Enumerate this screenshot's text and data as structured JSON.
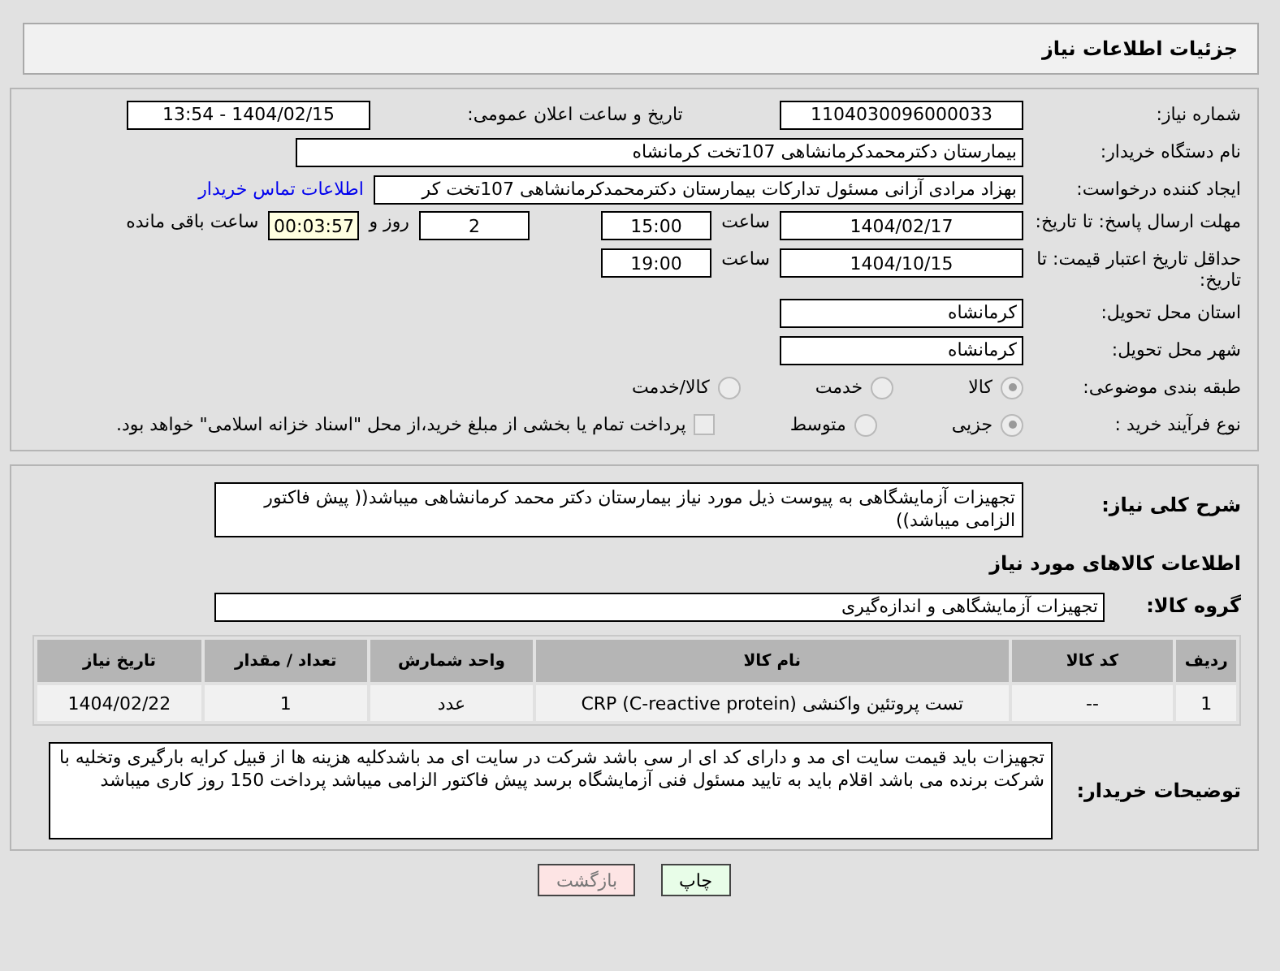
{
  "header": {
    "title": "جزئیات اطلاعات نیاز"
  },
  "fields": {
    "need_number": {
      "label": "شماره نیاز:",
      "value": "1104030096000033"
    },
    "announce": {
      "label": "تاریخ و ساعت اعلان عمومی:",
      "value": "1404/02/15 - 13:54"
    },
    "buyer_org": {
      "label": "نام دستگاه خریدار:",
      "value": "بیمارستان دکترمحمدکرمانشاهی 107تخت کرمانشاه"
    },
    "requester": {
      "label": "ایجاد کننده درخواست:",
      "value": "بهزاد مرادی آزانی مسئول تدارکات بیمارستان دکترمحمدکرمانشاهی 107تخت کر",
      "link": "اطلاعات تماس خریدار"
    },
    "deadline": {
      "label": "مهلت ارسال پاسخ: تا تاریخ:",
      "date": "1404/02/17",
      "time_label": "ساعت",
      "time": "15:00",
      "days": "2",
      "days_label": "روز و",
      "remaining": "00:03:57",
      "remaining_label": "ساعت باقی مانده"
    },
    "validity": {
      "label": "حداقل تاریخ اعتبار قیمت: تا تاریخ:",
      "date": "1404/10/15",
      "time_label": "ساعت",
      "time": "19:00"
    },
    "province": {
      "label": "استان محل تحویل:",
      "value": "کرمانشاه"
    },
    "city": {
      "label": "شهر محل تحویل:",
      "value": "کرمانشاه"
    },
    "category": {
      "label": "طبقه بندی موضوعی:",
      "options": [
        {
          "label": "کالا",
          "selected": true
        },
        {
          "label": "خدمت",
          "selected": false
        },
        {
          "label": "کالا/خدمت",
          "selected": false
        }
      ]
    },
    "process": {
      "label": "نوع فرآیند خرید :",
      "options": [
        {
          "label": "جزیی",
          "selected": true
        },
        {
          "label": "متوسط",
          "selected": false
        }
      ],
      "treasury": {
        "label": "پرداخت تمام یا بخشی از مبلغ خرید،از محل \"اسناد خزانه اسلامی\" خواهد بود.",
        "checked": false
      }
    }
  },
  "description": {
    "label": "شرح کلی نیاز:",
    "value": "تجهیزات آزمایشگاهی به پیوست ذیل مورد نیاز بیمارستان دکتر محمد کرمانشاهی میباشد(( پیش فاکتور الزامی میباشد))"
  },
  "goods_heading": "اطلاعات کالاهای مورد نیاز",
  "goods_group": {
    "label": "گروه کالا:",
    "value": "تجهیزات آزمایشگاهی و اندازه‌گیری"
  },
  "table": {
    "columns": [
      "ردیف",
      "کد کالا",
      "نام کالا",
      "واحد شمارش",
      "تعداد / مقدار",
      "تاریخ نیاز"
    ],
    "rows": [
      [
        "1",
        "--",
        "تست پروتئین واکنشی (CRP (C-reactive protein",
        "عدد",
        "1",
        "1404/02/22"
      ]
    ]
  },
  "buyer_notes": {
    "label": "توضیحات خریدار:",
    "value": "تجهیزات باید قیمت سایت ای مد و دارای کد ای ار سی باشد شرکت در سایت ای مد باشدکلیه هزینه ها از قبیل کرایه بارگیری وتخلیه با شرکت برنده می باشد اقلام باید به تایید مسئول فنی آزمایشگاه برسد پیش فاکتور الزامی میباشد پرداخت 150 روز کاری میباشد"
  },
  "buttons": [
    {
      "label": "چاپ",
      "kind": "print"
    },
    {
      "label": "بازگشت",
      "kind": "back"
    }
  ]
}
